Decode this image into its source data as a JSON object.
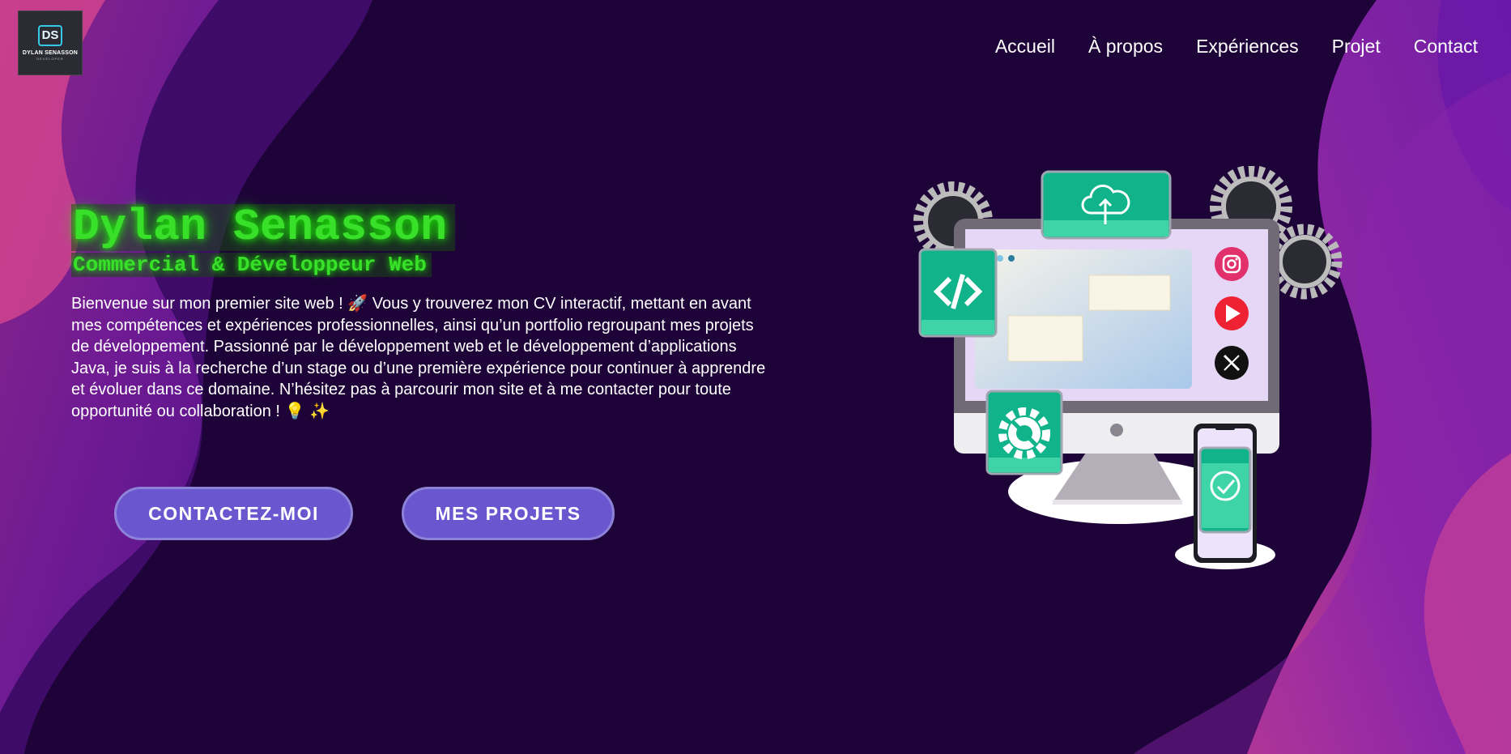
{
  "logo": {
    "mark": "DS",
    "name": "DYLAN SENASSON",
    "tagline": "DEVELOPER"
  },
  "nav": {
    "items": [
      {
        "label": "Accueil"
      },
      {
        "label": "À propos"
      },
      {
        "label": "Expériences"
      },
      {
        "label": "Projet"
      },
      {
        "label": "Contact"
      }
    ]
  },
  "hero": {
    "name": "Dylan Senasson",
    "subtitle": "Commercial & Développeur Web",
    "intro": "Bienvenue sur mon premier site web ! 🚀 Vous y trouverez mon CV interactif, mettant en avant mes compétences et expériences professionnelles, ainsi qu’un portfolio regroupant mes projets de développement. Passionné par le développement web et le développement d’applications Java, je suis à la recherche d’un stage ou d’une première expérience pour continuer à apprendre et évoluer dans ce domaine. N’hésitez pas à parcourir mon site et à me contacter pour toute opportunité ou collaboration ! 💡 ✨"
  },
  "buttons": {
    "contact": "CONTACTEZ-MOI",
    "projects": "MES PROJETS"
  },
  "illustration": {
    "icons": [
      "cloud-upload-icon",
      "code-icon",
      "gear-icon",
      "instagram-icon",
      "youtube-icon",
      "x-icon",
      "check-icon"
    ]
  },
  "colors": {
    "background": "#1e0338",
    "neon_green": "#38e02a",
    "button": "#6a57d0",
    "teal": "#10b98a",
    "wave_purple": "#6a1aa8",
    "wave_pink": "#e8508f"
  }
}
